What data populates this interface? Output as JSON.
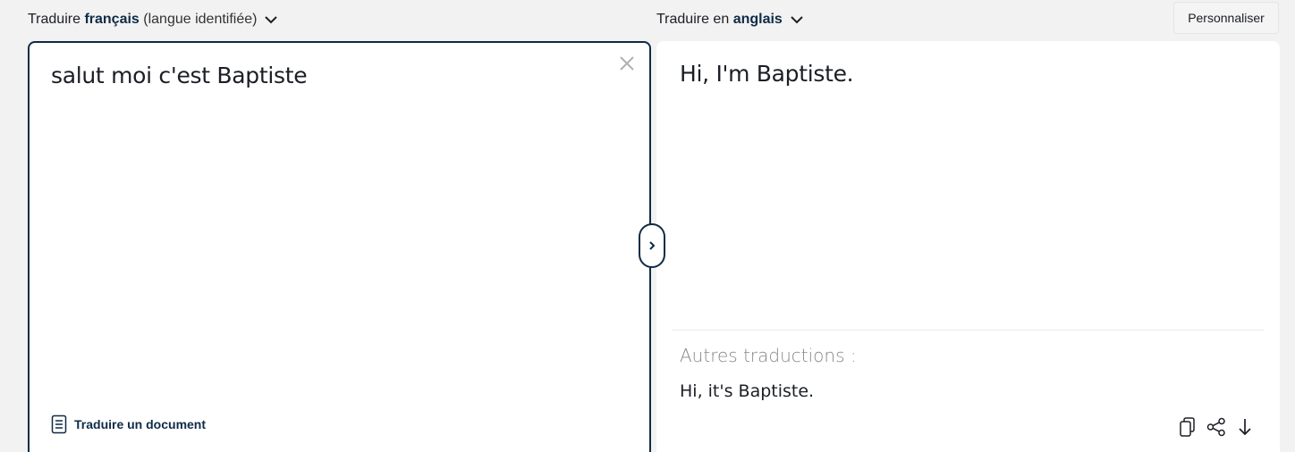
{
  "source_lang_bar": {
    "prefix": "Traduire",
    "language": "français",
    "suffix": "(langue identifiée)"
  },
  "target_lang_bar": {
    "prefix": "Traduire en",
    "language": "anglais"
  },
  "customize_button": {
    "label": "Personnaliser"
  },
  "source": {
    "text": "salut moi c'est Baptiste",
    "translate_document_label": "Traduire un document"
  },
  "target": {
    "text": "Hi, I'm Baptiste.",
    "alternatives_heading": "Autres traductions :",
    "alternatives": [
      "Hi, it's Baptiste."
    ]
  },
  "icons": {
    "source_chevron": "chevron-down-icon",
    "target_chevron": "chevron-down-icon",
    "clear": "close-icon",
    "document": "document-icon",
    "swap": "chevron-right-icon",
    "copy": "copy-icon",
    "share": "share-icon",
    "download": "arrow-down-icon"
  },
  "colors": {
    "accent_dark": "#0f2b46",
    "background": "#f2f2f2",
    "panel": "#ffffff",
    "muted_text": "#888888"
  }
}
